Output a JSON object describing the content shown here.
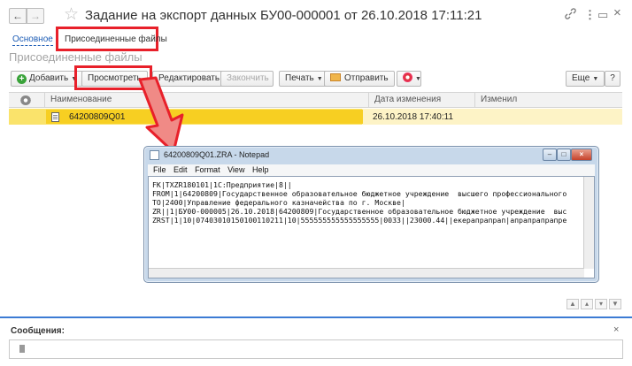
{
  "window": {
    "title": "Задание на экспорт данных БУ00-000001 от 26.10.2018 17:11:21",
    "back_icon": "←",
    "forward_icon": "→",
    "star_icon": "☆",
    "link_icon": "🔗",
    "menu_icon": "⋮",
    "maximize_icon": "▭",
    "close_icon": "×"
  },
  "tabs": {
    "main": "Основное",
    "files": "Присоединенные файлы"
  },
  "section_title": "Присоединенные файлы",
  "toolbar": {
    "add": "Добавить",
    "view": "Просмотреть",
    "edit": "Редактировать",
    "finish": "Закончить",
    "print": "Печать",
    "send": "Отправить",
    "more": "Еще",
    "help": "?"
  },
  "table": {
    "columns": [
      "Наименование",
      "Дата изменения",
      "Изменил"
    ],
    "rows": [
      {
        "name": "64200809Q01",
        "date": "26.10.2018 17:40:11",
        "changed_by": ""
      }
    ]
  },
  "notepad": {
    "title": "64200809Q01.ZRA - Notepad",
    "menu": [
      "File",
      "Edit",
      "Format",
      "View",
      "Help"
    ],
    "lines": [
      "FK|TXZR180101|1С:Предприятие|8||",
      "FROM|1|64200809|Государственное образовательное бюджетное учреждение  высшего профессионального",
      "TO|2400|Управление федерального казначейства по г. Москве|",
      "ZR||1|БУ00-000005|26.10.2018|64200809|Государственное образовательное бюджетное учреждение  выс",
      "ZRST|1|10|07403010150100110211|10|555555555555555555|0033||23000.44||екерапрапрап|апрапрапрапре"
    ]
  },
  "messages": {
    "title": "Сообщения:",
    "close_icon": "×"
  },
  "colors": {
    "accent_blue": "#3c7bd4",
    "selected_row": "#fae36b",
    "highlight_red": "#e8202a"
  }
}
